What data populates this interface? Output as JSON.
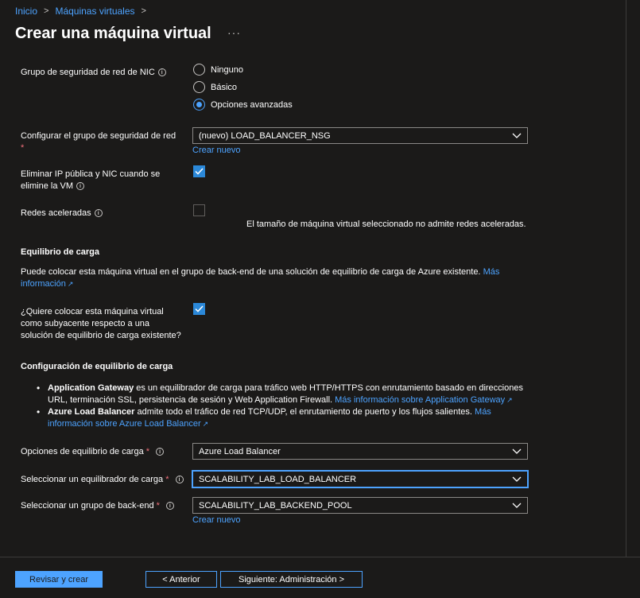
{
  "breadcrumb": {
    "home": "Inicio",
    "vms": "Máquinas virtuales",
    "sep": ">"
  },
  "page": {
    "title": "Crear una máquina virtual",
    "more": "···"
  },
  "nic_nsg": {
    "label": "Grupo de seguridad de red de NIC",
    "options": [
      "Ninguno",
      "Básico",
      "Opciones avanzadas"
    ],
    "selected": "Opciones avanzadas"
  },
  "config_nsg": {
    "label": "Configurar el grupo de seguridad de red",
    "required_mark": "*",
    "value": "(nuevo) LOAD_BALANCER_NSG",
    "create_new": "Crear nuevo"
  },
  "delete_ip": {
    "label_line1": "Eliminar IP pública y NIC cuando se",
    "label_line2": "elimine la VM",
    "checked": true
  },
  "accel_net": {
    "label": "Redes aceleradas",
    "checked": false,
    "note": "El tamaño de máquina virtual seleccionado no admite redes aceleradas."
  },
  "load_balancing": {
    "title": "Equilibrio de carga",
    "desc": "Puede colocar esta máquina virtual en el grupo de back-end de una solución de equilibrio de carga de Azure existente.",
    "more_line1": "Más",
    "more_line2": "información",
    "question_line1": "¿Quiere colocar esta máquina virtual",
    "question_line2": "como subyacente respecto a una",
    "question_line3": "solución de equilibrio de carga existente?",
    "checked": true
  },
  "lb_config": {
    "title": "Configuración de equilibrio de carga",
    "ag_name": "Application Gateway",
    "ag_text1": " es un equilibrador de carga para tráfico web HTTP/HTTPS con enrutamiento basado en direcciones",
    "ag_text2": "URL, terminación SSL, persistencia de sesión y Web Application Firewall.",
    "ag_link": "Más información sobre Application Gateway",
    "alb_name": "Azure Load Balancer",
    "alb_text": " admite todo el tráfico de red TCP/UDP, el enrutamiento de puerto y los flujos salientes.",
    "alb_link1": "Más",
    "alb_link2": "información sobre Azure Load Balancer"
  },
  "lb_options": {
    "label": "Opciones de equilibrio de carga",
    "required_mark": "*",
    "value": "Azure Load Balancer"
  },
  "lb_select": {
    "label": "Seleccionar un equilibrador de carga",
    "required_mark": "*",
    "value": "SCALABILITY_LAB_LOAD_BALANCER"
  },
  "backend_pool": {
    "label": "Seleccionar un grupo de back-end",
    "required_mark": "*",
    "value": "SCALABILITY_LAB_BACKEND_POOL",
    "create_new": "Crear nuevo"
  },
  "footer": {
    "review": "Revisar y crear",
    "previous": "< Anterior",
    "next": "Siguiente: Administración >"
  },
  "icons": {
    "info": "i",
    "external": "↗"
  },
  "colors": {
    "accent": "#4da3ff",
    "background": "#1b1a19",
    "required": "#f1707b"
  }
}
